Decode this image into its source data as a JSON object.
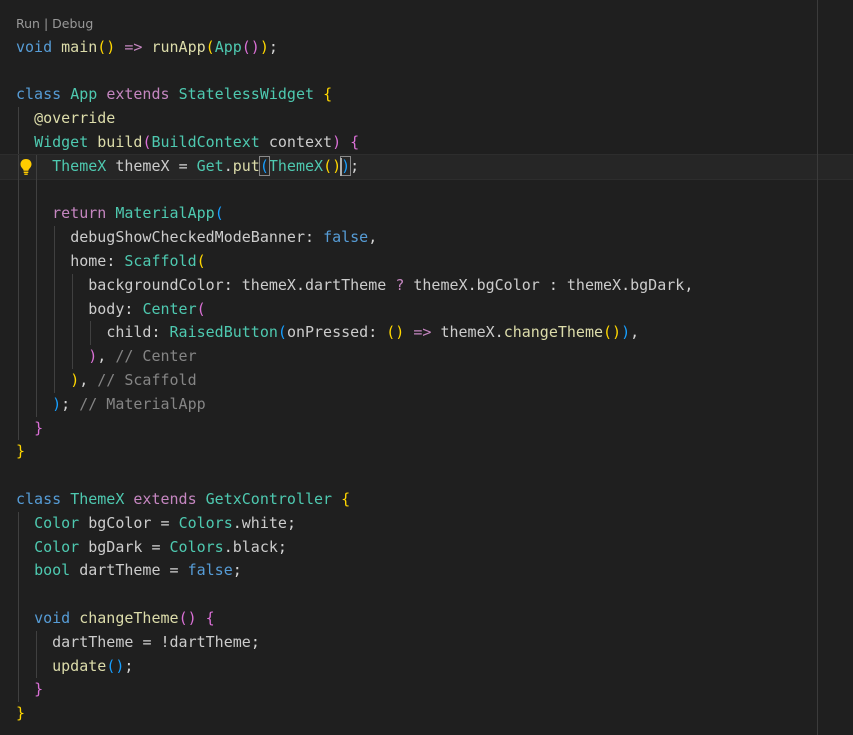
{
  "codelens": {
    "run": "Run",
    "sep": " | ",
    "debug": "Debug"
  },
  "lines": [
    [
      [
        "k",
        "void"
      ],
      [
        "w",
        " "
      ],
      [
        "f",
        "main"
      ],
      [
        "b1",
        "()"
      ],
      [
        "w",
        " "
      ],
      [
        "arrow",
        "=>"
      ],
      [
        "w",
        " "
      ],
      [
        "f",
        "runApp"
      ],
      [
        "b1",
        "("
      ],
      [
        "t",
        "App"
      ],
      [
        "b2",
        "()"
      ],
      [
        "b1",
        ")"
      ],
      [
        "p",
        ";"
      ]
    ],
    [],
    [
      [
        "k",
        "class"
      ],
      [
        "w",
        " "
      ],
      [
        "t",
        "App"
      ],
      [
        "w",
        " "
      ],
      [
        "kc",
        "extends"
      ],
      [
        "w",
        " "
      ],
      [
        "t",
        "StatelessWidget"
      ],
      [
        "w",
        " "
      ],
      [
        "b1",
        "{"
      ]
    ],
    [
      [
        "w",
        "  "
      ],
      [
        "an",
        "@override"
      ]
    ],
    [
      [
        "w",
        "  "
      ],
      [
        "t",
        "Widget"
      ],
      [
        "w",
        " "
      ],
      [
        "f",
        "build"
      ],
      [
        "b2",
        "("
      ],
      [
        "t",
        "BuildContext"
      ],
      [
        "w",
        " "
      ],
      [
        "w",
        "context"
      ],
      [
        "b2",
        ")"
      ],
      [
        "w",
        " "
      ],
      [
        "b2",
        "{"
      ]
    ],
    [
      [
        "w",
        "    "
      ],
      [
        "t",
        "ThemeX"
      ],
      [
        "w",
        " "
      ],
      [
        "w",
        "themeX"
      ],
      [
        "w",
        " "
      ],
      [
        "p",
        "="
      ],
      [
        "w",
        " "
      ],
      [
        "t",
        "Get"
      ],
      [
        "p",
        "."
      ],
      [
        "f",
        "put"
      ],
      [
        "b3",
        "("
      ],
      [
        "t",
        "ThemeX"
      ],
      [
        "b1",
        "()"
      ],
      [
        "b3",
        ")"
      ],
      [
        "p",
        ";"
      ]
    ],
    [],
    [
      [
        "w",
        "    "
      ],
      [
        "kc",
        "return"
      ],
      [
        "w",
        " "
      ],
      [
        "t",
        "MaterialApp"
      ],
      [
        "b3",
        "("
      ]
    ],
    [
      [
        "w",
        "      "
      ],
      [
        "w",
        "debugShowCheckedModeBanner"
      ],
      [
        "p",
        ":"
      ],
      [
        "w",
        " "
      ],
      [
        "lit",
        "false"
      ],
      [
        "p",
        ","
      ]
    ],
    [
      [
        "w",
        "      "
      ],
      [
        "w",
        "home"
      ],
      [
        "p",
        ":"
      ],
      [
        "w",
        " "
      ],
      [
        "t",
        "Scaffold"
      ],
      [
        "b1",
        "("
      ]
    ],
    [
      [
        "w",
        "        "
      ],
      [
        "w",
        "backgroundColor"
      ],
      [
        "p",
        ":"
      ],
      [
        "w",
        " "
      ],
      [
        "w",
        "themeX"
      ],
      [
        "p",
        "."
      ],
      [
        "w",
        "dartTheme"
      ],
      [
        "w",
        " "
      ],
      [
        "q",
        "?"
      ],
      [
        "w",
        " "
      ],
      [
        "w",
        "themeX"
      ],
      [
        "p",
        "."
      ],
      [
        "w",
        "bgColor"
      ],
      [
        "w",
        " "
      ],
      [
        "p",
        ":"
      ],
      [
        "w",
        " "
      ],
      [
        "w",
        "themeX"
      ],
      [
        "p",
        "."
      ],
      [
        "w",
        "bgDark"
      ],
      [
        "p",
        ","
      ]
    ],
    [
      [
        "w",
        "        "
      ],
      [
        "w",
        "body"
      ],
      [
        "p",
        ":"
      ],
      [
        "w",
        " "
      ],
      [
        "t",
        "Center"
      ],
      [
        "b2",
        "("
      ]
    ],
    [
      [
        "w",
        "          "
      ],
      [
        "w",
        "child"
      ],
      [
        "p",
        ":"
      ],
      [
        "w",
        " "
      ],
      [
        "t",
        "RaisedButton"
      ],
      [
        "b3",
        "("
      ],
      [
        "w",
        "onPressed"
      ],
      [
        "p",
        ":"
      ],
      [
        "w",
        " "
      ],
      [
        "b1",
        "()"
      ],
      [
        "w",
        " "
      ],
      [
        "arrow",
        "=>"
      ],
      [
        "w",
        " "
      ],
      [
        "w",
        "themeX"
      ],
      [
        "p",
        "."
      ],
      [
        "f",
        "changeTheme"
      ],
      [
        "b1",
        "()"
      ],
      [
        "b3",
        ")"
      ],
      [
        "p",
        ","
      ]
    ],
    [
      [
        "w",
        "        "
      ],
      [
        "b2",
        ")"
      ],
      [
        "p",
        ","
      ],
      [
        "w",
        " "
      ],
      [
        "cg",
        "// Center"
      ]
    ],
    [
      [
        "w",
        "      "
      ],
      [
        "b1",
        ")"
      ],
      [
        "p",
        ","
      ],
      [
        "w",
        " "
      ],
      [
        "cg",
        "// Scaffold"
      ]
    ],
    [
      [
        "w",
        "    "
      ],
      [
        "b3",
        ")"
      ],
      [
        "p",
        ";"
      ],
      [
        "w",
        " "
      ],
      [
        "cg",
        "// MaterialApp"
      ]
    ],
    [
      [
        "w",
        "  "
      ],
      [
        "b2",
        "}"
      ]
    ],
    [
      [
        "b1",
        "}"
      ]
    ],
    [],
    [
      [
        "k",
        "class"
      ],
      [
        "w",
        " "
      ],
      [
        "t",
        "ThemeX"
      ],
      [
        "w",
        " "
      ],
      [
        "kc",
        "extends"
      ],
      [
        "w",
        " "
      ],
      [
        "t",
        "GetxController"
      ],
      [
        "w",
        " "
      ],
      [
        "b1",
        "{"
      ]
    ],
    [
      [
        "w",
        "  "
      ],
      [
        "t",
        "Color"
      ],
      [
        "w",
        " "
      ],
      [
        "w",
        "bgColor"
      ],
      [
        "w",
        " "
      ],
      [
        "p",
        "="
      ],
      [
        "w",
        " "
      ],
      [
        "t",
        "Colors"
      ],
      [
        "p",
        "."
      ],
      [
        "w",
        "white"
      ],
      [
        "p",
        ";"
      ]
    ],
    [
      [
        "w",
        "  "
      ],
      [
        "t",
        "Color"
      ],
      [
        "w",
        " "
      ],
      [
        "w",
        "bgDark"
      ],
      [
        "w",
        " "
      ],
      [
        "p",
        "="
      ],
      [
        "w",
        " "
      ],
      [
        "t",
        "Colors"
      ],
      [
        "p",
        "."
      ],
      [
        "w",
        "black"
      ],
      [
        "p",
        ";"
      ]
    ],
    [
      [
        "w",
        "  "
      ],
      [
        "t",
        "bool"
      ],
      [
        "w",
        " "
      ],
      [
        "w",
        "dartTheme"
      ],
      [
        "w",
        " "
      ],
      [
        "p",
        "="
      ],
      [
        "w",
        " "
      ],
      [
        "lit",
        "false"
      ],
      [
        "p",
        ";"
      ]
    ],
    [],
    [
      [
        "w",
        "  "
      ],
      [
        "k",
        "void"
      ],
      [
        "w",
        " "
      ],
      [
        "f",
        "changeTheme"
      ],
      [
        "b2",
        "()"
      ],
      [
        "w",
        " "
      ],
      [
        "b2",
        "{"
      ]
    ],
    [
      [
        "w",
        "    "
      ],
      [
        "w",
        "dartTheme"
      ],
      [
        "w",
        " "
      ],
      [
        "p",
        "="
      ],
      [
        "w",
        " "
      ],
      [
        "p",
        "!"
      ],
      [
        "w",
        "dartTheme"
      ],
      [
        "p",
        ";"
      ]
    ],
    [
      [
        "w",
        "    "
      ],
      [
        "f",
        "update"
      ],
      [
        "b3",
        "()"
      ],
      [
        "p",
        ";"
      ]
    ],
    [
      [
        "w",
        "  "
      ],
      [
        "b2",
        "}"
      ]
    ],
    [
      [
        "b1",
        "}"
      ]
    ]
  ],
  "guides": [
    [],
    [],
    [],
    [
      0
    ],
    [
      0
    ],
    [
      0,
      1
    ],
    [
      0,
      1
    ],
    [
      0,
      1
    ],
    [
      0,
      1,
      2
    ],
    [
      0,
      1,
      2
    ],
    [
      0,
      1,
      2,
      3
    ],
    [
      0,
      1,
      2,
      3
    ],
    [
      0,
      1,
      2,
      3,
      4
    ],
    [
      0,
      1,
      2,
      3
    ],
    [
      0,
      1,
      2
    ],
    [
      0,
      1
    ],
    [
      0
    ],
    [],
    [],
    [],
    [
      0
    ],
    [
      0
    ],
    [
      0
    ],
    [
      0
    ],
    [
      0
    ],
    [
      0,
      1
    ],
    [
      0,
      1
    ],
    [
      0
    ],
    []
  ],
  "current_line": 5
}
